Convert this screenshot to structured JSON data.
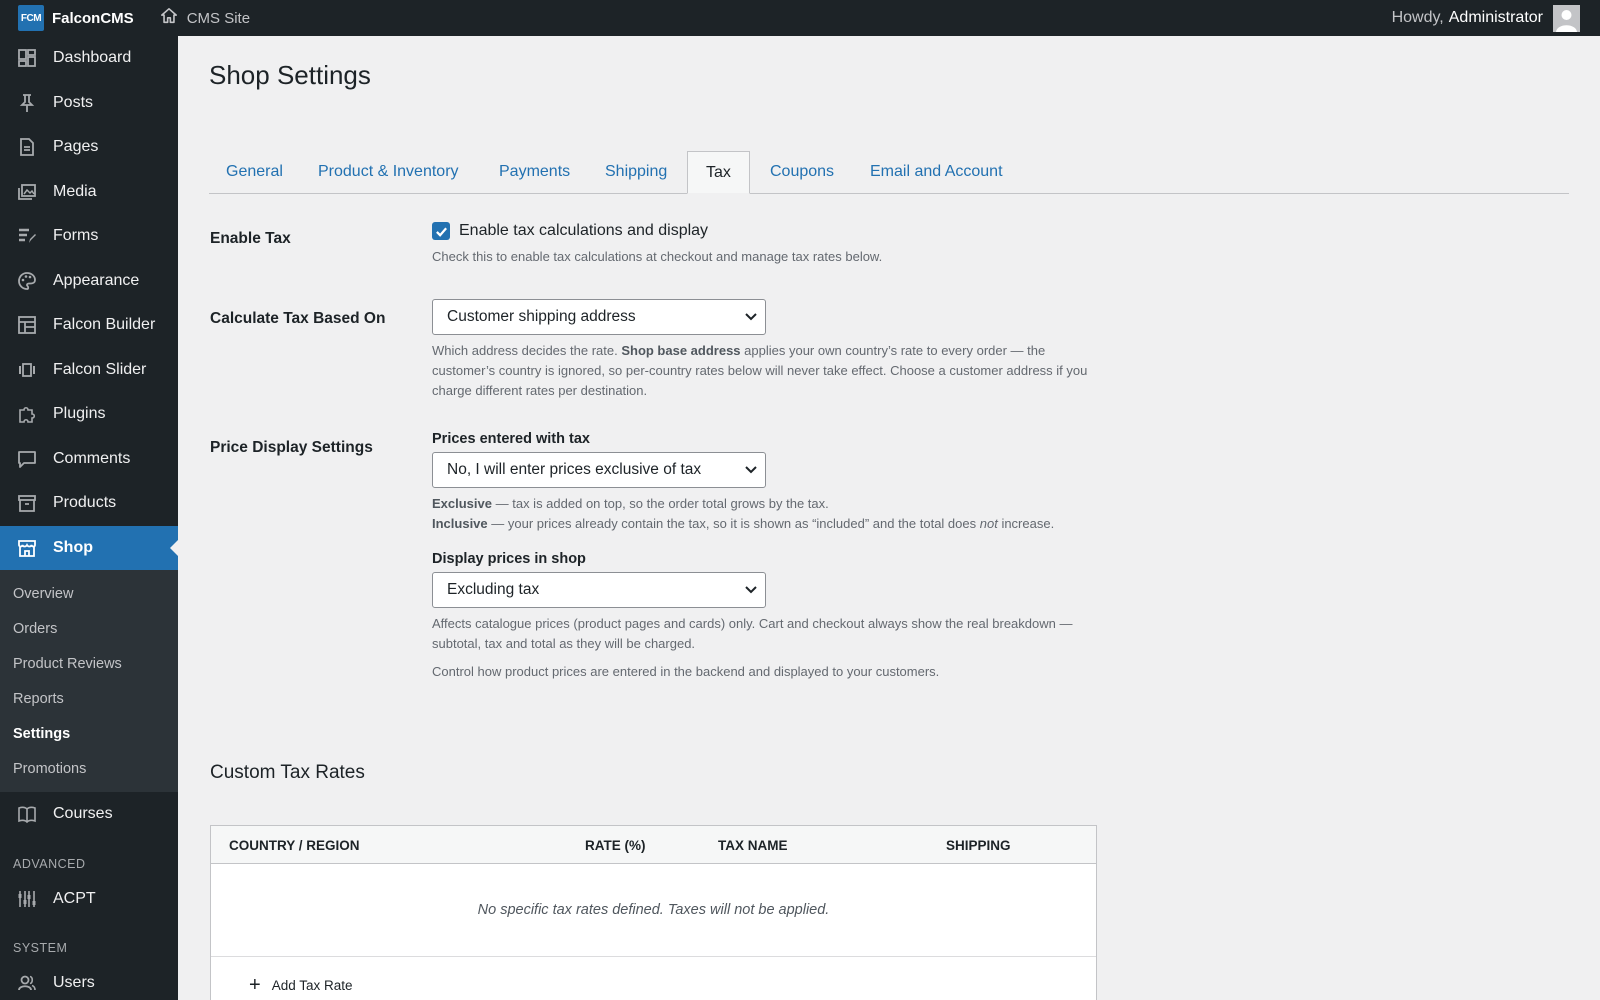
{
  "topbar": {
    "brand_logo": "FCM",
    "brand_name": "FalconCMS",
    "site_label": "CMS Site",
    "howdy_prefix": "Howdy,",
    "howdy_user": "Administrator"
  },
  "sidebar": {
    "items": [
      {
        "label": "Dashboard",
        "icon": "dashboard-icon"
      },
      {
        "label": "Posts",
        "icon": "pin-icon"
      },
      {
        "label": "Pages",
        "icon": "page-icon"
      },
      {
        "label": "Media",
        "icon": "media-icon"
      },
      {
        "label": "Forms",
        "icon": "forms-icon"
      },
      {
        "label": "Appearance",
        "icon": "palette-icon"
      },
      {
        "label": "Falcon Builder",
        "icon": "layout-icon"
      },
      {
        "label": "Falcon Slider",
        "icon": "slider-icon"
      },
      {
        "label": "Plugins",
        "icon": "plugin-icon"
      },
      {
        "label": "Comments",
        "icon": "comment-icon"
      },
      {
        "label": "Products",
        "icon": "archive-icon"
      },
      {
        "label": "Shop",
        "icon": "store-icon"
      }
    ],
    "shop_submenu": [
      "Overview",
      "Orders",
      "Product Reviews",
      "Reports",
      "Settings",
      "Promotions"
    ],
    "courses_label": "Courses",
    "advanced_label": "ADVANCED",
    "acpt_label": "ACPT",
    "system_label": "SYSTEM",
    "users_label": "Users"
  },
  "page": {
    "title": "Shop Settings",
    "tabs": [
      "General",
      "Product & Inventory",
      "Payments",
      "Shipping",
      "Tax",
      "Coupons",
      "Email and Account"
    ],
    "active_tab": "Tax"
  },
  "tax": {
    "enable_label": "Enable Tax",
    "enable_checkbox_text": "Enable tax calculations and display",
    "enable_checked": true,
    "enable_desc": "Check this to enable tax calculations at checkout and manage tax rates below.",
    "based_on_label": "Calculate Tax Based On",
    "based_on_value": "Customer shipping address",
    "based_on_desc_1": "Which address decides the rate. ",
    "based_on_desc_bold": "Shop base address",
    "based_on_desc_2": " applies your own country’s rate to every order — the customer’s country is ignored, so per-country rates below will never take effect. Choose a customer address if you charge different rates per destination.",
    "price_display_label": "Price Display Settings",
    "prices_entered_label": "Prices entered with tax",
    "prices_entered_value": "No, I will enter prices exclusive of tax",
    "exclusive_bold": "Exclusive",
    "exclusive_text": " — tax is added on top, so the order total grows by the tax.",
    "inclusive_bold": "Inclusive",
    "inclusive_text_1": " — your prices already contain the tax, so it is shown as “included” and the total does ",
    "inclusive_not": "not",
    "inclusive_text_2": " increase.",
    "display_prices_label": "Display prices in shop",
    "display_prices_value": "Excluding tax",
    "display_prices_desc": "Affects catalogue prices (product pages and cards) only. Cart and checkout always show the real breakdown — subtotal, tax and total as they will be charged.",
    "control_desc": "Control how product prices are entered in the backend and displayed to your customers."
  },
  "rates": {
    "title": "Custom Tax Rates",
    "columns": [
      "COUNTRY / REGION",
      "RATE (%)",
      "TAX NAME",
      "SHIPPING"
    ],
    "empty_text": "No specific tax rates defined. Taxes will not be applied.",
    "add_label": "Add Tax Rate"
  },
  "colors": {
    "accent": "#2271b1",
    "sidebar_bg": "#1d2327",
    "submenu_bg": "#2c3338"
  }
}
